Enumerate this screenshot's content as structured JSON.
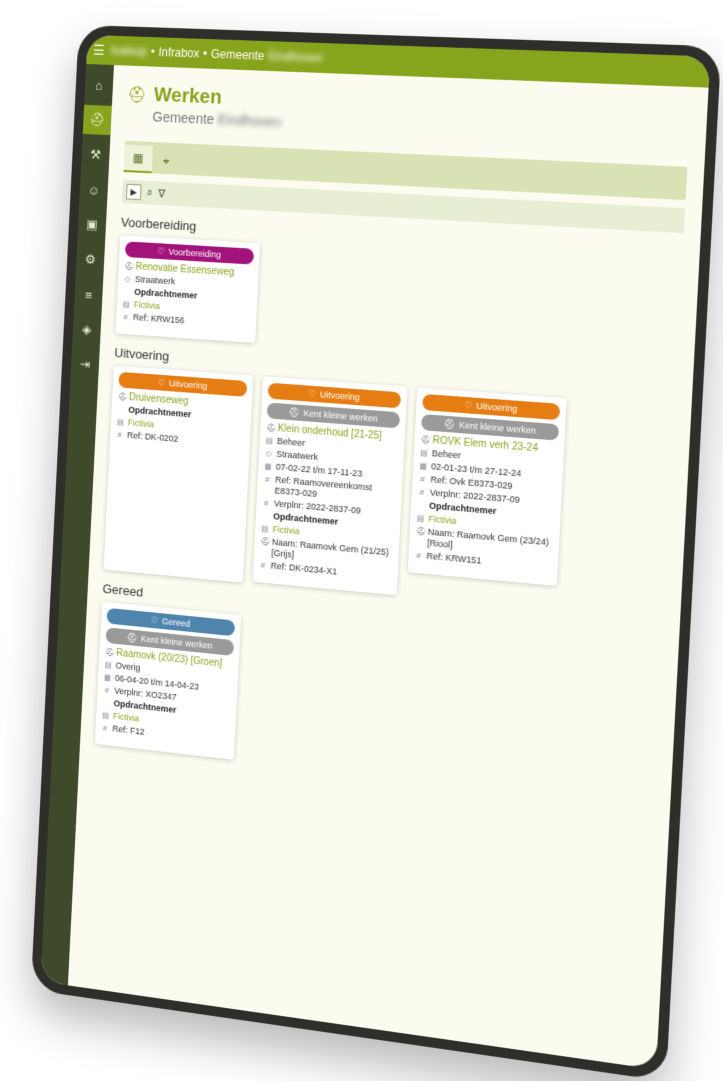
{
  "topbar": {
    "crumb_1": "Infrabox",
    "crumb_2": "Gemeente"
  },
  "sidebar": {
    "items": [
      "home",
      "works",
      "assets",
      "people",
      "contacts",
      "users",
      "layers",
      "packages",
      "logout"
    ]
  },
  "page": {
    "title": "Werken",
    "subtitle": "Gemeente"
  },
  "sections": {
    "voorbereiding": "Voorbereiding",
    "uitvoering": "Uitvoering",
    "gereed": "Gereed"
  },
  "cards": {
    "c1": {
      "status": "Voorbereiding",
      "project": "Renovatie Essenseweg",
      "type": "Straatwerk",
      "contractor_label": "Opdrachtnemer",
      "contractor": "Fictivia",
      "ref": "Ref: KRW156"
    },
    "c2": {
      "status": "Uitvoering",
      "project": "Druivenseweg",
      "contractor_label": "Opdrachtnemer",
      "contractor": "Fictivia",
      "ref": "Ref: DK-0202"
    },
    "c3": {
      "status": "Uitvoering",
      "flag": "Kent kleine werken",
      "project": "Klein onderhoud [21-25]",
      "category": "Beheer",
      "type": "Straatwerk",
      "dates": "07-02-22 t/m 17-11-23",
      "ref": "Ref: Raamovereenkomst E8373-029",
      "verplnr": "Verplnr: 2022-2837-09",
      "contractor_label": "Opdrachtnemer",
      "contractor": "Fictivia",
      "naam": "Naam: Raamovk Gem (21/25) [Grijs]",
      "ref2": "Ref: DK-0234-X1"
    },
    "c4": {
      "status": "Uitvoering",
      "flag": "Kent kleine werken",
      "project": "ROVK Elem verh 23-24",
      "category": "Beheer",
      "dates": "02-01-23 t/m 27-12-24",
      "ref": "Ref: Ovk E8373-029",
      "verplnr": "Verplnr: 2022-2837-09",
      "contractor_label": "Opdrachtnemer",
      "contractor": "Fictivia",
      "naam": "Naam: Raamovk Gem (23/24) [Riool]",
      "ref2": "Ref: KRW151"
    },
    "c5": {
      "status": "Gereed",
      "flag": "Kent kleine werken",
      "project": "Raamovk (20/23) [Groen]",
      "category": "Overig",
      "dates": "06-04-20 t/m 14-04-23",
      "verplnr": "Verplnr: XO2347",
      "contractor_label": "Opdrachtnemer",
      "contractor": "Fictivia",
      "ref": "Ref: F12"
    }
  },
  "colors": {
    "brand": "#87a51c",
    "purple": "#a2147c",
    "orange": "#e57d13",
    "blue": "#4f85ad",
    "gray": "#9a9a9a"
  }
}
